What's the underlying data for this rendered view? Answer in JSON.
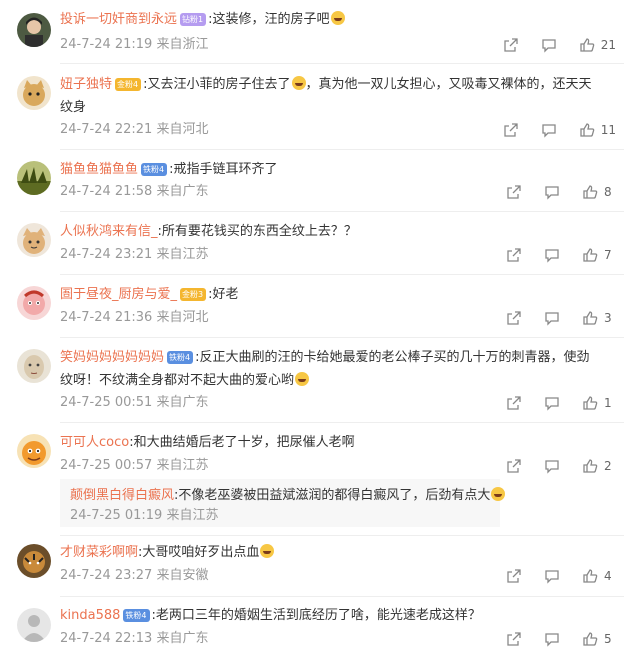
{
  "comments": [
    {
      "user": "投诉一切奸商到永远",
      "badge": "钻粉1",
      "badge_color": "#b59cf0",
      "text": ":这装修，汪的房子吧",
      "emoji": "laugh-cry",
      "time": "24-7-24 21:19",
      "location": "来自浙江",
      "likes": "21",
      "avatar_color": "#3f4a38"
    },
    {
      "user": "妞子独特",
      "badge": "金粉4",
      "badge_color": "#f4b62f",
      "text": ":又去汪小菲的房子住去了",
      "emoji": "laugh-cry",
      "text2a": "，真为他一双儿女担心，又吸毒又裸体的，还天天",
      "text2": "纹身",
      "time": "24-7-24 22:21",
      "location": "来自河北",
      "likes": "11",
      "avatar_color": "#d9b06a"
    },
    {
      "user": "猫鱼鱼猫鱼鱼",
      "badge": "铁粉4",
      "badge_color": "#5a8fe0",
      "text": ":戒指手链耳环齐了",
      "time": "24-7-24 21:58",
      "location": "来自广东",
      "likes": "8",
      "avatar_color": "#6d7a2e"
    },
    {
      "user": "人似秋鸿来有信_",
      "text": ":所有要花钱买的东西全纹上去？？",
      "time": "24-7-24 23:21",
      "location": "来自江苏",
      "likes": "7",
      "avatar_color": "#e8c9a0"
    },
    {
      "user": "圄于昼夜_厨房与爱_",
      "badge": "金粉3",
      "badge_color": "#f4b62f",
      "text": ":好老",
      "time": "24-7-24 21:36",
      "location": "来自河北",
      "likes": "3",
      "avatar_color": "#f2b8b8"
    },
    {
      "user": "笑妈妈妈妈妈妈妈",
      "badge": "铁粉4",
      "badge_color": "#5a8fe0",
      "text": ":反正大曲刷的汪的卡给她最爱的老公棒子买的几十万的刺青器，使劲",
      "text2": "纹呀！不纹满全身都对不起大曲的爱心哟",
      "emoji2": "laugh",
      "time": "24-7-25 00:51",
      "location": "来自广东",
      "likes": "1",
      "avatar_color": "#d8d0c4"
    },
    {
      "user": "可可人coco",
      "text": ":和大曲结婚后老了十岁，把尿催人老啊",
      "time": "24-7-25 00:57",
      "location": "来自江苏",
      "likes": "2",
      "avatar_color": "#f0a23a",
      "reply": {
        "user": "颠倒黑白得白癜风",
        "text": ":不像老巫婆被田益斌滋润的都得白癜风了，后劲有点大",
        "time": "24-7-25 01:19",
        "location": "来自江苏"
      }
    },
    {
      "user": "才财菜彩啊啊",
      "text": ":大哥哎咱好歹出点血",
      "emoji": "smile",
      "time": "24-7-24 23:27",
      "location": "来自安徽",
      "likes": "4",
      "avatar_color": "#8a6a3a"
    },
    {
      "user": "kinda588",
      "badge": "铁粉4",
      "badge_color": "#5a8fe0",
      "text": ":老两口三年的婚姻生活到底经历了啥，能光速老成这样？",
      "time": "24-7-24 22:13",
      "location": "来自广东",
      "likes": "5",
      "avatar_color": "#d9d9d9"
    }
  ],
  "colors": {
    "username": "#eb7350",
    "meta": "#999999",
    "text": "#333333"
  },
  "icons": {
    "share": "share-icon",
    "comment": "comment-icon",
    "like": "like-icon"
  }
}
